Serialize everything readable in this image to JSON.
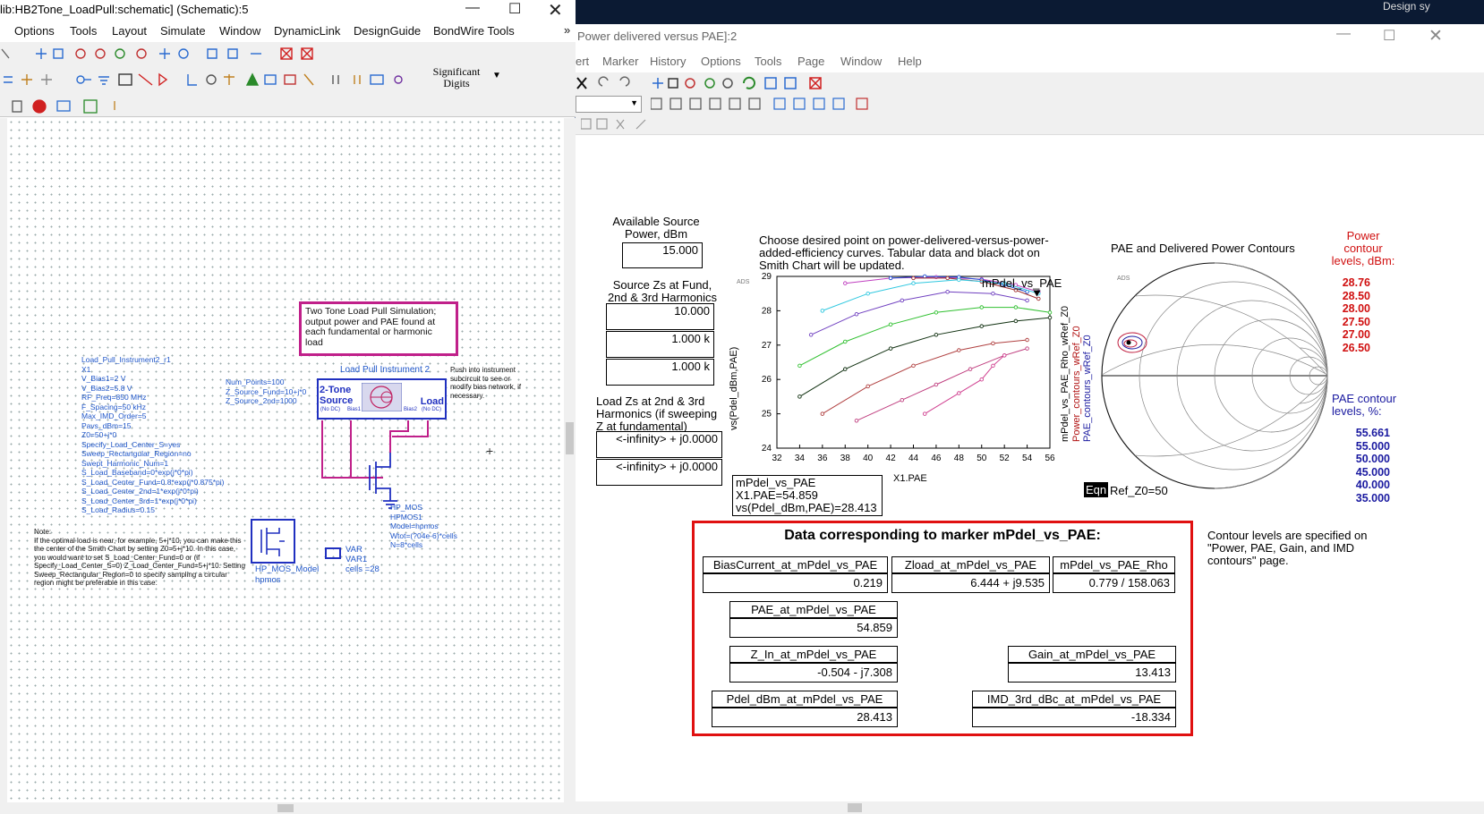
{
  "left_window": {
    "title": "lib:HB2Tone_LoadPull:schematic] (Schematic):5",
    "menu": [
      "Options",
      "Tools",
      "Layout",
      "Simulate",
      "Window",
      "DynamicLink",
      "DesignGuide",
      "BondWire Tools"
    ],
    "menu_overflow": "»",
    "significant_digits_label": "Significant Digits",
    "note_box": "Two Tone Load Pull Simulation; output power and PAE found at each fundamental or harmonic load",
    "instrument_label": "Load Pull Instrument 2",
    "instrument_source_label": "2-Tone Source",
    "instrument_load_label": "Load",
    "instrument_nodc_left": "(No DC)",
    "instrument_nodc_right": "(No DC)",
    "instrument_bias1": "Bias1",
    "instrument_bias2": "Bias2",
    "push_note": "Push into instrument subcircuit to see or modify bias network, if necessary.",
    "source_params": [
      "Num_Points=100",
      "Z_Source_Fund=10+j*0",
      "Z_Source_2nd=1000"
    ],
    "instrument_params": [
      "Load_Pull_Instrument2_r1",
      "X1",
      "V_Bias1=2 V",
      "V_Bias2=5.8 V",
      "RF_Freq=850 MHz",
      "F_Spacing=50 kHz",
      "Max_IMD_Order=5",
      "Pavs_dBm=15",
      "Z0=50+j*0",
      "Specify_Load_Center_S=yes",
      "Sweep_Rectangular_Region=no",
      "Swept_Harmonic_Num=1",
      "S_Load_Baseband=0*exp(j*0*pi)",
      "S_Load_Center_Fund=0.8*exp(j*0.875*pi)",
      "S_Load_Center_2nd=1*exp(j*0*pi)",
      "S_Load_Center_3rd=1*exp(j*0*pi)",
      "S_Load_Radius=0.15"
    ],
    "transistor_params": [
      "HP_MOS",
      "HPMOS1",
      "Model=hpmos",
      "Wtot=(?04e-6)*cells",
      "N=8*cells"
    ],
    "model_label": "HP_MOS_Model",
    "model_name": "hpmos",
    "var_label": "VAR",
    "var_name": "VAR1",
    "var_value": "cells =28",
    "note_text": "Note:\nIf the optimal load is near, for example, 5+j*10, you can make this the center of the Smith Chart by setting Z0=5+j*10. In this case, you would want to set S_Load_Center_Fund=0 or (if Specify_Load_Center_S=0) Z_Load_Center_Fund=5+j*10. Setting Sweep_Rectangular_Region=0 to specify sampling a circular region might be preferable in this case."
  },
  "right_window": {
    "title": "Power delivered versus PAE]:2",
    "menu": [
      "ert",
      "Marker",
      "History",
      "Options",
      "Tools",
      "Page",
      "Window",
      "Help"
    ],
    "top_right_text": "Design sy",
    "available_source_label": "Available Source Power, dBm",
    "available_source_value": "15.000",
    "source_zs_label": "Source Zs at Fund, 2nd & 3rd Harmonics",
    "source_zs_values": [
      "10.000",
      "1.000 k",
      "1.000 k"
    ],
    "load_zs_label": "Load Zs at 2nd & 3rd Harmonics (if sweeping Z at fundamental)",
    "load_zs_values": [
      "<-infinity> + j0.0000",
      "<-infinity> + j0.0000"
    ],
    "instructions": "Choose desired point on power-delivered-versus-power-added-efficiency curves.  Tabular data and black dot on Smith Chart will be updated.",
    "plot_title": "mPdel_vs_PAE",
    "ads_tag": "ADS",
    "marker_readout": [
      "mPdel_vs_PAE",
      "X1.PAE=54.859",
      "vs(Pdel_dBm,PAE)=28.413"
    ],
    "smith_title": "PAE and Delivered Power Contours",
    "smith_side_labels": [
      "mPdel_vs_PAE_Rho_wRef_Z0",
      "Power_contours_wRef_Z0",
      "PAE_contours_wRef_Z0"
    ],
    "eqn_label": "Eqn",
    "ref_z0": "Ref_Z0=50",
    "power_contour_title": "Power contour levels, dBm:",
    "power_levels": [
      "28.76",
      "28.50",
      "28.00",
      "27.50",
      "27.00",
      "26.50"
    ],
    "pae_contour_title": "PAE contour levels, %:",
    "pae_levels": [
      "55.661",
      "55.000",
      "50.000",
      "45.000",
      "40.000",
      "35.000"
    ],
    "contour_note": "Contour levels are specified on \"Power, PAE, Gain, and IMD contours\" page.",
    "data_title": "Data corresponding to marker mPdel_vs_PAE:",
    "data_fields": {
      "bias_label": "BiasCurrent_at_mPdel_vs_PAE",
      "bias_value": "0.219",
      "zload_label": "Zload_at_mPdel_vs_PAE",
      "zload_value": "6.444 + j9.535",
      "rho_label": "mPdel_vs_PAE_Rho",
      "rho_value": "0.779 / 158.063",
      "pae_label": "PAE_at_mPdel_vs_PAE",
      "pae_value": "54.859",
      "zin_label": "Z_In_at_mPdel_vs_PAE",
      "zin_value": "-0.504 - j7.308",
      "gain_label": "Gain_at_mPdel_vs_PAE",
      "gain_value": "13.413",
      "pdel_label": "Pdel_dBm_at_mPdel_vs_PAE",
      "pdel_value": "28.413",
      "imd_label": "IMD_3rd_dBc_at_mPdel_vs_PAE",
      "imd_value": "-18.334"
    }
  },
  "chart_data": {
    "type": "line",
    "title": "mPdel_vs_PAE",
    "xlabel": "X1.PAE",
    "ylabel": "vs(Pdel_dBm,PAE)",
    "xlim": [
      32,
      56
    ],
    "ylim": [
      24,
      29
    ],
    "x_ticks": [
      "32",
      "34",
      "36",
      "38",
      "40",
      "42",
      "44",
      "46",
      "48",
      "50",
      "52",
      "54",
      "56"
    ],
    "y_ticks": [
      "24",
      "25",
      "26",
      "27",
      "28",
      "29"
    ],
    "series": [
      {
        "color": "#c040c0",
        "points": [
          [
            38,
            28.8
          ],
          [
            42,
            28.95
          ],
          [
            46,
            28.98
          ],
          [
            50,
            28.92
          ],
          [
            53,
            28.75
          ],
          [
            55,
            28.55
          ]
        ]
      },
      {
        "color": "#2050d0",
        "points": [
          [
            42,
            28.95
          ],
          [
            45,
            29.0
          ],
          [
            48,
            28.98
          ],
          [
            50,
            28.9
          ],
          [
            52,
            28.75
          ],
          [
            54,
            28.55
          ]
        ]
      },
      {
        "color": "#a03030",
        "points": [
          [
            44,
            28.95
          ],
          [
            47,
            28.95
          ],
          [
            50,
            28.85
          ],
          [
            53,
            28.6
          ],
          [
            55,
            28.35
          ]
        ]
      },
      {
        "color": "#30c8e0",
        "points": [
          [
            36,
            28.0
          ],
          [
            40,
            28.5
          ],
          [
            44,
            28.8
          ],
          [
            48,
            28.9
          ],
          [
            52,
            28.8
          ],
          [
            55,
            28.5
          ]
        ]
      },
      {
        "color": "#7040c0",
        "points": [
          [
            35,
            27.3
          ],
          [
            39,
            27.9
          ],
          [
            43,
            28.3
          ],
          [
            47,
            28.55
          ],
          [
            51,
            28.5
          ],
          [
            54,
            28.3
          ]
        ]
      },
      {
        "color": "#30c030",
        "points": [
          [
            34,
            26.4
          ],
          [
            38,
            27.1
          ],
          [
            42,
            27.6
          ],
          [
            46,
            27.95
          ],
          [
            50,
            28.1
          ],
          [
            53,
            28.1
          ],
          [
            56,
            27.95
          ]
        ]
      },
      {
        "color": "#103010",
        "points": [
          [
            34,
            25.5
          ],
          [
            38,
            26.3
          ],
          [
            42,
            26.9
          ],
          [
            46,
            27.3
          ],
          [
            50,
            27.55
          ],
          [
            53,
            27.7
          ],
          [
            56,
            27.8
          ]
        ]
      },
      {
        "color": "#b04040",
        "points": [
          [
            36,
            25.0
          ],
          [
            40,
            25.8
          ],
          [
            44,
            26.4
          ],
          [
            48,
            26.85
          ],
          [
            51,
            27.05
          ],
          [
            54,
            27.15
          ]
        ]
      },
      {
        "color": "#c04080",
        "points": [
          [
            39,
            24.8
          ],
          [
            43,
            25.4
          ],
          [
            46,
            25.85
          ],
          [
            49,
            26.3
          ],
          [
            52,
            26.7
          ],
          [
            54,
            26.9
          ]
        ]
      },
      {
        "color": "#d04090",
        "points": [
          [
            45,
            25.0
          ],
          [
            48,
            25.6
          ],
          [
            50,
            26.0
          ],
          [
            51,
            26.4
          ],
          [
            52,
            26.7
          ]
        ]
      }
    ],
    "marker": {
      "x": 54.859,
      "y": 28.413
    }
  }
}
